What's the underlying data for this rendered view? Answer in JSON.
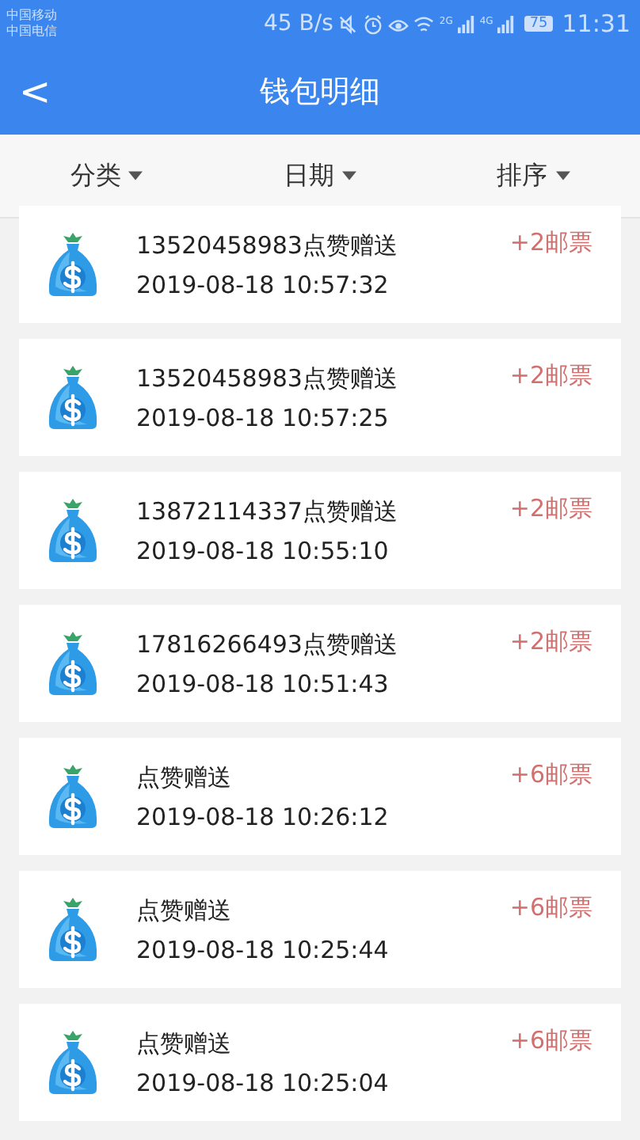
{
  "status_bar": {
    "carriers": [
      "中国移动",
      "中国电信"
    ],
    "speed": "45 B/s",
    "signal_labels": [
      "2G",
      "4G"
    ],
    "battery": "75",
    "time": "11:31"
  },
  "header": {
    "back": "<",
    "title": "钱包明细"
  },
  "filters": [
    {
      "label": "分类"
    },
    {
      "label": "日期"
    },
    {
      "label": "排序"
    }
  ],
  "records": [
    {
      "title": "13520458983点赞赠送",
      "time": "2019-08-18 10:57:32",
      "amount": "+2邮票"
    },
    {
      "title": "13520458983点赞赠送",
      "time": "2019-08-18 10:57:25",
      "amount": "+2邮票"
    },
    {
      "title": "13872114337点赞赠送",
      "time": "2019-08-18 10:55:10",
      "amount": "+2邮票"
    },
    {
      "title": "17816266493点赞赠送",
      "time": "2019-08-18 10:51:43",
      "amount": "+2邮票"
    },
    {
      "title": "点赞赠送",
      "time": "2019-08-18 10:26:12",
      "amount": "+6邮票"
    },
    {
      "title": "点赞赠送",
      "time": "2019-08-18 10:25:44",
      "amount": "+6邮票"
    },
    {
      "title": "点赞赠送",
      "time": "2019-08-18 10:25:04",
      "amount": "+6邮票"
    }
  ]
}
